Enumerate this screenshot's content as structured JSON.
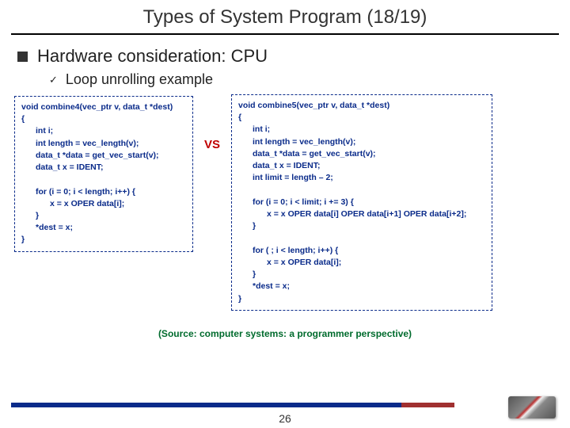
{
  "title": "Types of System Program (18/19)",
  "bullet1": "Hardware consideration: CPU",
  "sub1": "Loop unrolling example",
  "vs": "VS",
  "codeLeft": {
    "l1": "void combine4(vec_ptr v, data_t *dest)",
    "l2": "{",
    "l3": "int i;",
    "l4": "int length = vec_length(v);",
    "l5": "data_t *data = get_vec_start(v);",
    "l6": "data_t x = IDENT;",
    "l7": "for (i = 0; i < length; i++) {",
    "l8": "x = x OPER data[i];",
    "l9": "}",
    "l10": "*dest = x;",
    "l11": "}"
  },
  "codeRight": {
    "l1": "void combine5(vec_ptr v, data_t *dest)",
    "l2": "{",
    "l3": "int i;",
    "l4": "int length = vec_length(v);",
    "l5": "data_t *data = get_vec_start(v);",
    "l6": "data_t x = IDENT;",
    "l7": "int limit = length – 2;",
    "l8": "for (i = 0; i < limit; i += 3) {",
    "l9": "x = x OPER data[i] OPER data[i+1] OPER data[i+2];",
    "l10": "}",
    "l11": "for ( ; i < length; i++) {",
    "l12": "x = x OPER data[i];",
    "l13": "}",
    "l14": "*dest = x;",
    "l15": "}"
  },
  "source": "(Source: computer systems: a programmer perspective)",
  "pageNum": "26"
}
